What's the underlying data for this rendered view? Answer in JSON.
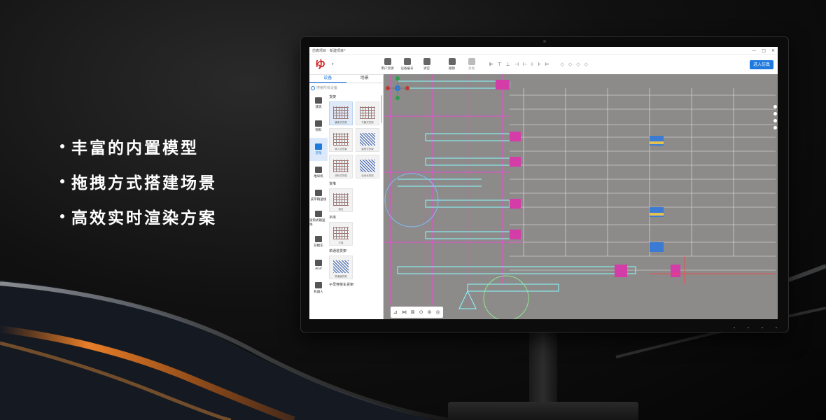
{
  "features": [
    "丰富的内置模型",
    "拖拽方式搭建场景",
    "高效实时渲染方案"
  ],
  "app": {
    "window_title": "仿真项目 - 新建项目*",
    "window_controls": [
      "—",
      "□",
      "✕"
    ],
    "toolbar": {
      "buttons": [
        {
          "label": "用户资源",
          "icon": "user-resource-icon"
        },
        {
          "label": "设备编号",
          "icon": "device-number-icon"
        },
        {
          "label": "清空",
          "icon": "clear-icon"
        },
        {
          "label": "撤销",
          "icon": "undo-icon"
        },
        {
          "label": "重做",
          "icon": "redo-icon"
        }
      ],
      "align_icons": [
        "⊫",
        "⊤",
        "⊥",
        "⊣",
        "⊢",
        "⊦",
        "⊧",
        "⊨"
      ],
      "round_icons": [
        "◇",
        "◇",
        "◇",
        "◇"
      ],
      "enter_button": "进入仿真"
    },
    "sidebar": {
      "tabs": [
        "设备",
        "场景"
      ],
      "search_placeholder": "搜索所有设备",
      "categories": [
        "建筑",
        "物料",
        "货架",
        "堆垛机",
        "皮带输送线",
        "滚筒式输送线",
        "穿梭车",
        "AGV",
        "机器人"
      ],
      "active_category": 2,
      "sections": [
        {
          "title": "货架",
          "items": [
            "横梁式货架",
            "牛腿式货架",
            "驶入式货架",
            "重型式货架",
            "流利式货架",
            "自动化货架"
          ]
        },
        {
          "title": "货堆",
          "items": [
            "堆位"
          ]
        },
        {
          "title": "平库",
          "items": [
            "平库"
          ]
        },
        {
          "title": "单通道货架",
          "items": [
            "单通道货架"
          ]
        },
        {
          "title": "子母穿梭车货架",
          "items": []
        }
      ]
    },
    "canvas": {
      "background": "#8d8a8a",
      "bottom_tools": [
        "⊿",
        "⋈",
        "⊠",
        "⊙",
        "⊛",
        "◎"
      ]
    }
  },
  "colors": {
    "accent": "#1f7ae0",
    "brand": "#d21f1f"
  }
}
